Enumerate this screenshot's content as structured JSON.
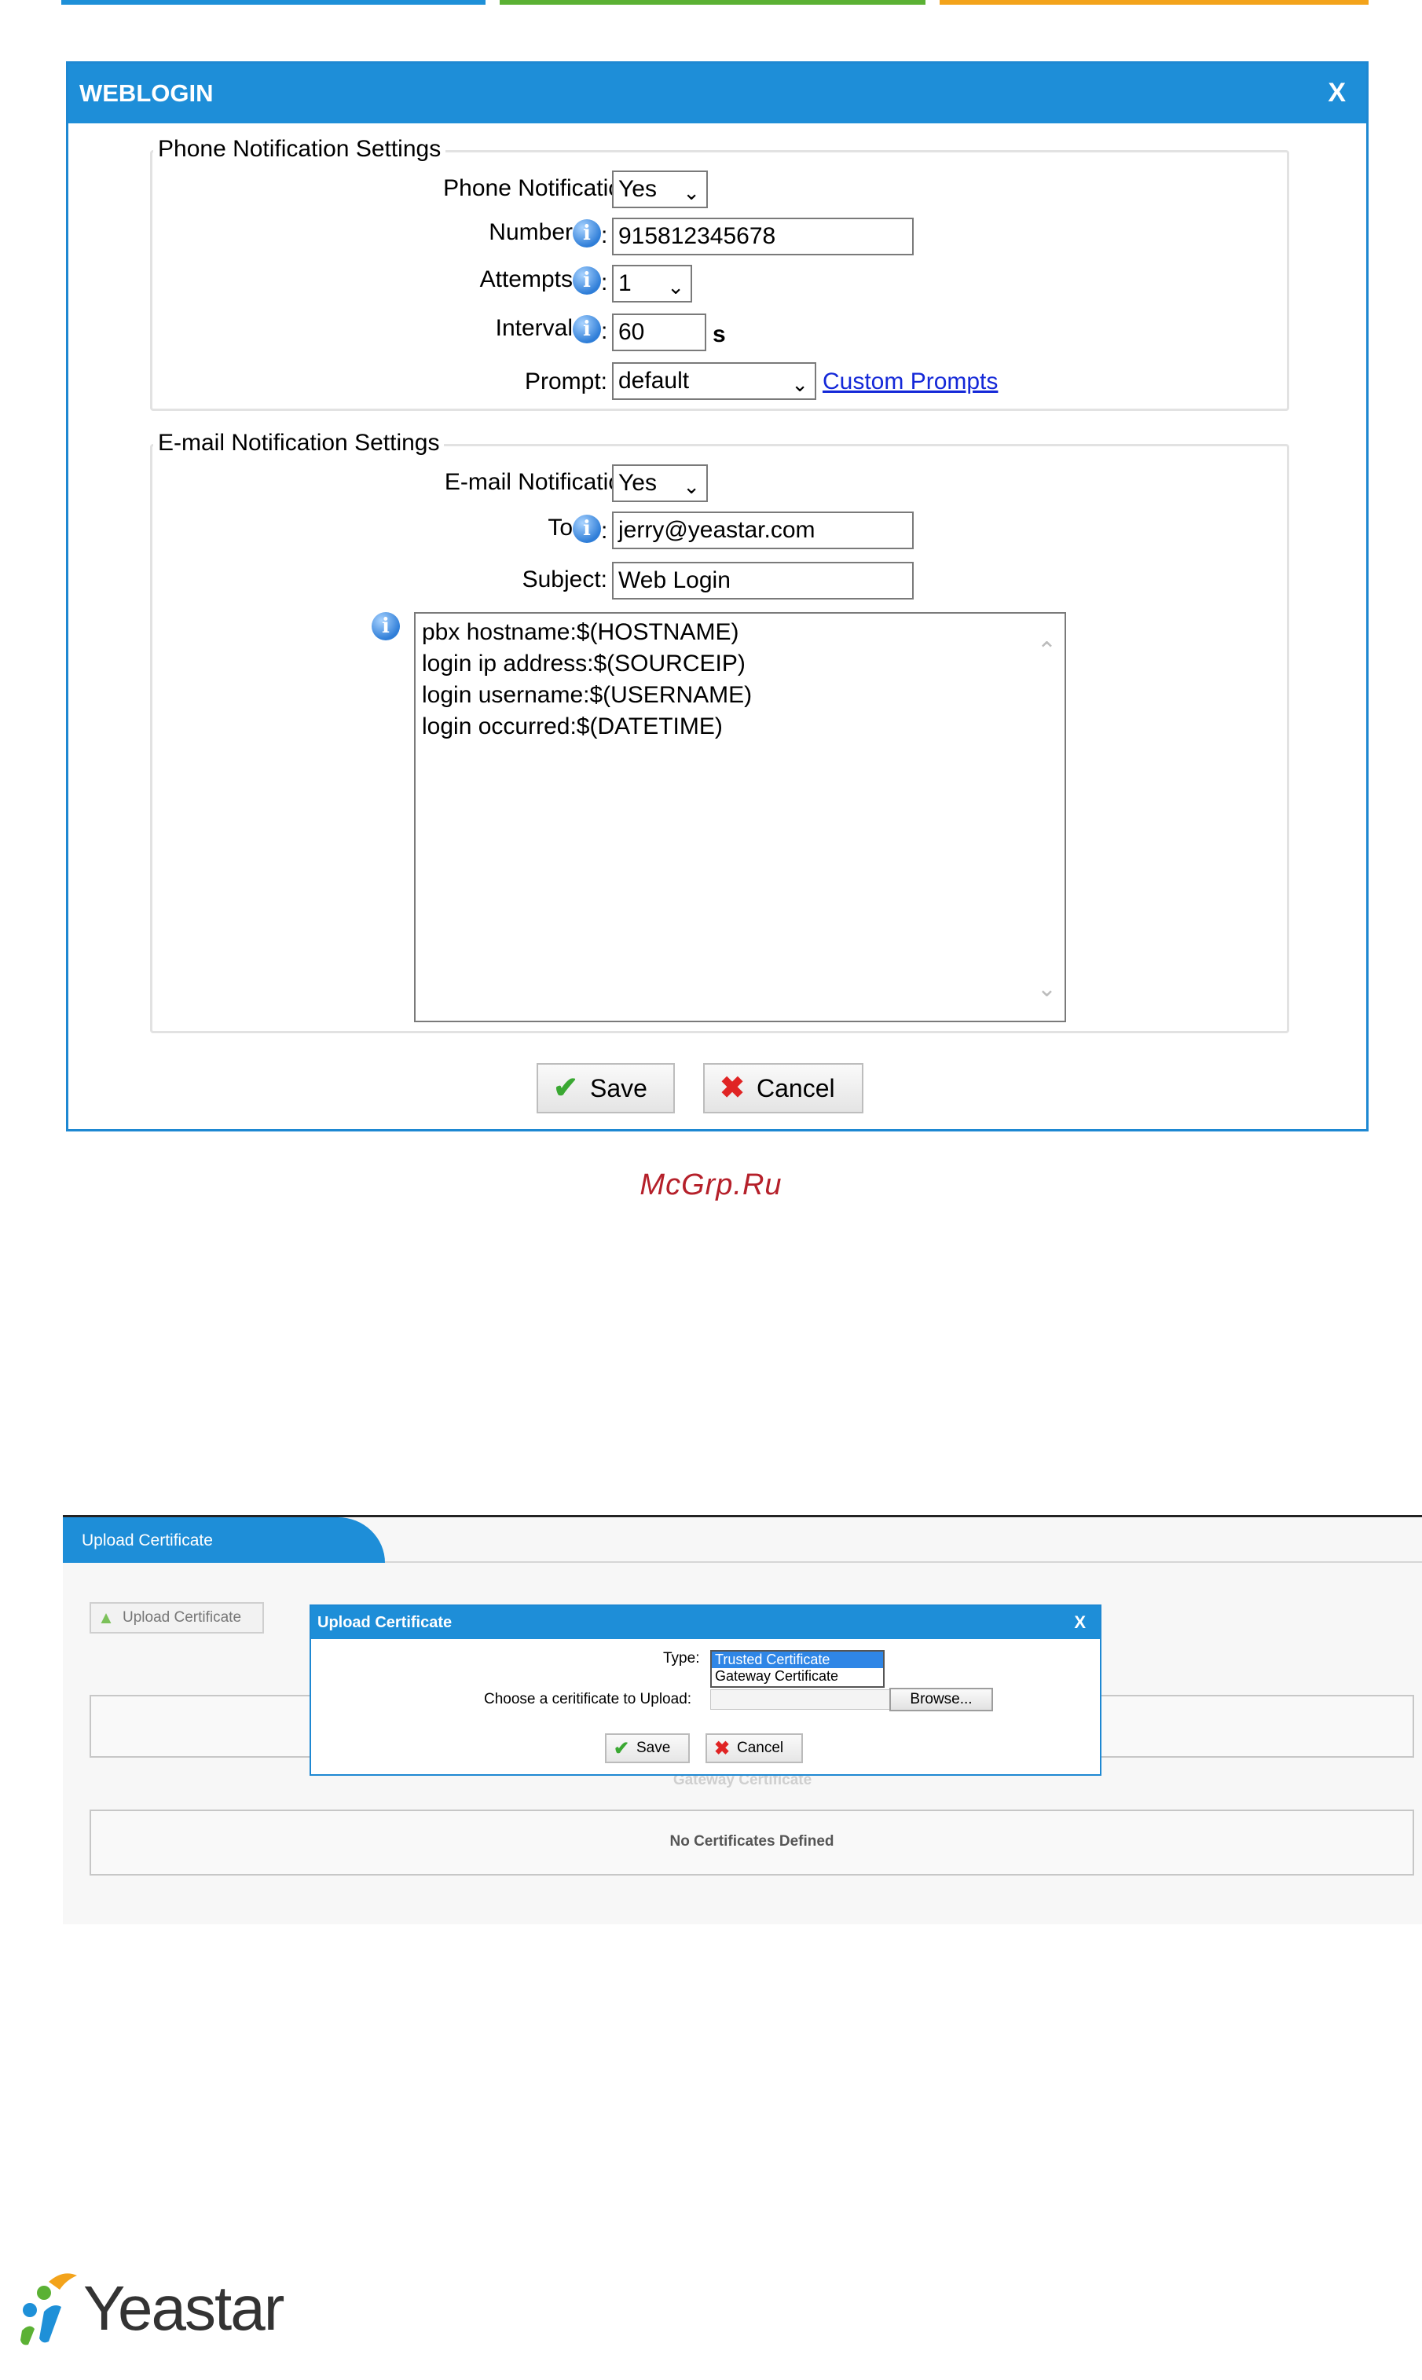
{
  "weblogin": {
    "title": "WEBLOGIN",
    "close": "X",
    "phone": {
      "legend": "Phone Notification Settings",
      "notification_label": "Phone Notification:",
      "notification_value": "Yes",
      "number_label": "Number",
      "number_value": "915812345678",
      "attempts_label": "Attempts",
      "attempts_value": "1",
      "interval_label": "Interval",
      "interval_value": "60",
      "interval_unit": "s",
      "prompt_label": "Prompt:",
      "prompt_value": "default",
      "custom_prompts": "Custom Prompts"
    },
    "email": {
      "legend": "E-mail Notification Settings",
      "notification_label": "E-mail Notification:",
      "notification_value": "Yes",
      "to_label": "To",
      "to_value": "jerry@yeastar.com",
      "subject_label": "Subject:",
      "subject_value": "Web Login",
      "body_lines": [
        "pbx hostname:$(HOSTNAME)",
        "login ip address:$(SOURCEIP)",
        "login username:$(USERNAME)",
        "login occurred:$(DATETIME)"
      ]
    },
    "save": "Save",
    "cancel": "Cancel",
    "colon": ":"
  },
  "watermark": "McGrp.Ru",
  "upload_cert": {
    "tab": "Upload Certificate",
    "toolbar_button": "Upload Certificate",
    "gateway_heading": "Gateway Certificate",
    "no_certs": "No Certificates Defined",
    "dialog": {
      "title": "Upload Certificate",
      "close": "X",
      "type_label": "Type:",
      "type_options": [
        "Trusted Certificate",
        "Gateway Certificate"
      ],
      "choose_label": "Choose a ceritificate to Upload:",
      "browse": "Browse...",
      "save": "Save",
      "cancel": "Cancel"
    }
  },
  "logo": {
    "text": "Yeastar"
  },
  "colors": {
    "accent_blue": "#1e8ed8",
    "top_bars": [
      "#1e90d8",
      "#5bb134",
      "#f3a31b"
    ]
  }
}
